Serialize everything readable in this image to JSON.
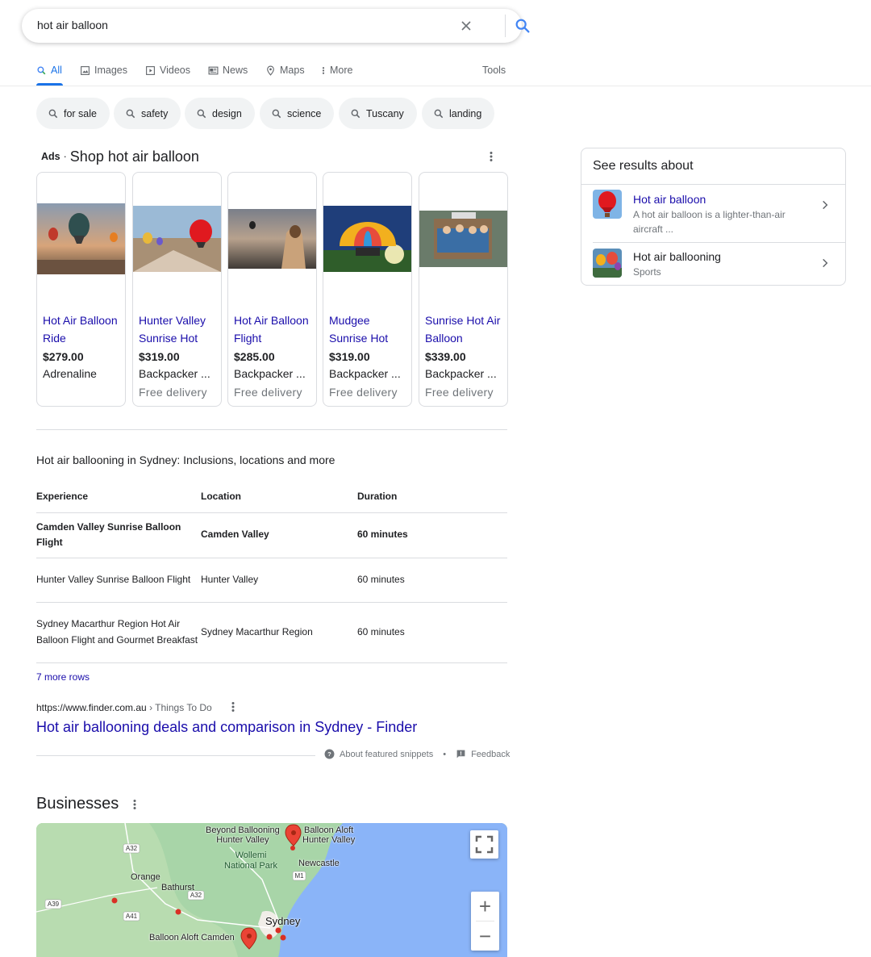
{
  "search": {
    "query": "hot air balloon"
  },
  "tabs": [
    {
      "label": "All",
      "icon": "search-icon"
    },
    {
      "label": "Images",
      "icon": "image-icon"
    },
    {
      "label": "Videos",
      "icon": "video-icon"
    },
    {
      "label": "News",
      "icon": "news-icon"
    },
    {
      "label": "Maps",
      "icon": "map-pin-icon"
    },
    {
      "label": "More",
      "icon": "more-vert-icon"
    }
  ],
  "tools_label": "Tools",
  "chips": [
    "for sale",
    "safety",
    "design",
    "science",
    "Tuscany",
    "landing"
  ],
  "ads": {
    "badge": "Ads",
    "separator": "·",
    "title": "Shop hot air balloon",
    "products": [
      {
        "name": "Hot Air Balloon Ride",
        "price": "$279.00",
        "seller": "Adrenaline",
        "delivery": ""
      },
      {
        "name": "Hunter Valley Sunrise Hot",
        "price": "$319.00",
        "seller": "Backpacker ...",
        "delivery": "Free delivery"
      },
      {
        "name": "Hot Air Balloon Flight",
        "price": "$285.00",
        "seller": "Backpacker ...",
        "delivery": "Free delivery"
      },
      {
        "name": "Mudgee Sunrise Hot",
        "price": "$319.00",
        "seller": "Backpacker ...",
        "delivery": "Free delivery"
      },
      {
        "name": "Sunrise Hot Air Balloon",
        "price": "$339.00",
        "seller": "Backpacker ...",
        "delivery": "Free delivery"
      }
    ]
  },
  "snippet": {
    "title": "Hot air ballooning in Sydney: Inclusions, locations and more",
    "headers": [
      "Experience",
      "Location",
      "Duration"
    ],
    "rows": [
      [
        "Camden Valley Sunrise Balloon Flight",
        "Camden Valley",
        "60 minutes"
      ],
      [
        "Hunter Valley Sunrise Balloon Flight",
        "Hunter Valley",
        "60 minutes"
      ],
      [
        "Sydney Macarthur Region Hot Air Balloon Flight and Gourmet Breakfast",
        "Sydney Macarthur Region",
        "60 minutes"
      ]
    ],
    "more_rows": "7 more rows",
    "url": "https://www.finder.com.au",
    "breadcrumb": " › Things To Do",
    "result_title": "Hot air ballooning deals and comparison in Sydney - Finder",
    "about_label": "About featured snippets",
    "bullet": "•",
    "feedback_label": "Feedback"
  },
  "businesses": {
    "title": "Businesses",
    "map_labels": {
      "beyond": "Beyond Ballooning\nHunter Valley",
      "aloft_hunter": "Balloon Aloft\nHunter Valley",
      "wollemi": "Wollemi\nNational Park",
      "newcastle": "Newcastle",
      "orange": "Orange",
      "bathurst": "Bathurst",
      "sydney": "Sydney",
      "camden": "Balloon Aloft Camden",
      "a32a": "A32",
      "a32b": "A32",
      "m1": "M1",
      "a39": "A39",
      "a41": "A41"
    },
    "zoom_in": "+",
    "zoom_out": "−"
  },
  "knowledge": {
    "head": "See results about",
    "items": [
      {
        "name": "Hot air balloon",
        "sub": "A hot air balloon is a lighter-than-air aircraft ..."
      },
      {
        "name": "Hot air ballooning",
        "sub": "Sports"
      }
    ]
  },
  "colors": {
    "link": "#1a0dab",
    "accent": "#1a73e8",
    "chip_bg": "#f1f3f4",
    "map_water": "#8ab4f8",
    "map_land": "#a3d4a5"
  }
}
